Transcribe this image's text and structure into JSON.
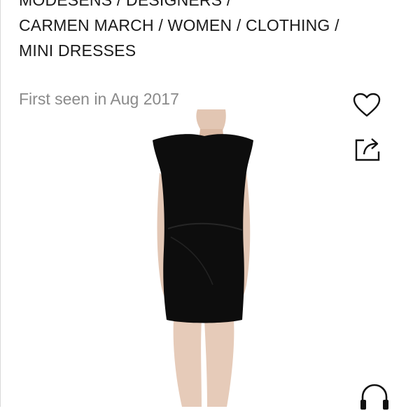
{
  "breadcrumb": {
    "lines": [
      "MODESENS / DESIGNERS /",
      "CARMEN MARCH / WOMEN / CLOTHING /",
      "MINI DRESSES"
    ]
  },
  "product": {
    "first_seen": "First seen in Aug 2017"
  },
  "icons": {
    "favorite": "heart-icon",
    "share": "share-icon",
    "support": "headset-icon"
  },
  "colors": {
    "text": "#1a1a1a",
    "muted": "#8a8a8a",
    "dress": "#0d0d0d"
  }
}
